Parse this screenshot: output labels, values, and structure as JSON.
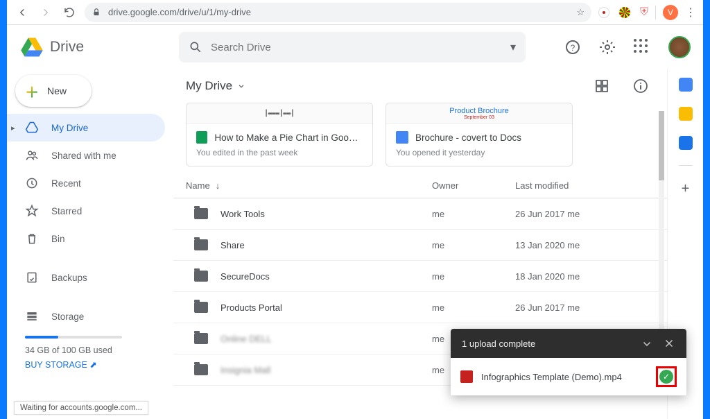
{
  "url": "drive.google.com/drive/u/1/my-drive",
  "chrome_avatar_letter": "V",
  "drive_title": "Drive",
  "search_placeholder": "Search Drive",
  "new_button": "New",
  "sidebar": {
    "my_drive": "My Drive",
    "shared": "Shared with me",
    "recent": "Recent",
    "starred": "Starred",
    "bin": "Bin",
    "backups": "Backups",
    "storage": "Storage",
    "storage_used": "34 GB of 100 GB used",
    "buy": "BUY STORAGE"
  },
  "breadcrumb": "My Drive",
  "quick_access": [
    {
      "icon": "sheets",
      "title": "How to Make a Pie Chart in Google S...",
      "sub": "You edited in the past week",
      "thumb_text": ""
    },
    {
      "icon": "docs",
      "title": "Brochure - covert to Docs",
      "sub": "You opened it yesterday",
      "thumb_text": "Product Brochure"
    }
  ],
  "columns": {
    "name": "Name",
    "owner": "Owner",
    "modified": "Last modified"
  },
  "rows": [
    {
      "name": "Work Tools",
      "owner": "me",
      "modified": "26 Jun 2017",
      "you": "me"
    },
    {
      "name": "Share",
      "owner": "me",
      "modified": "13 Jan 2020",
      "you": "me"
    },
    {
      "name": "SecureDocs",
      "owner": "me",
      "modified": "18 Jan 2020",
      "you": "me"
    },
    {
      "name": "Products Portal",
      "owner": "me",
      "modified": "26 Jun 2017",
      "you": "me"
    },
    {
      "name": "Online DELL",
      "owner": "me",
      "modified": "",
      "you": "",
      "blur": true
    },
    {
      "name": "Insignia Mall",
      "owner": "me",
      "modified": "",
      "you": "",
      "blur": true
    }
  ],
  "toast": {
    "header": "1 upload complete",
    "file": "Infographics Template (Demo).mp4"
  },
  "status": "Waiting for accounts.google.com..."
}
